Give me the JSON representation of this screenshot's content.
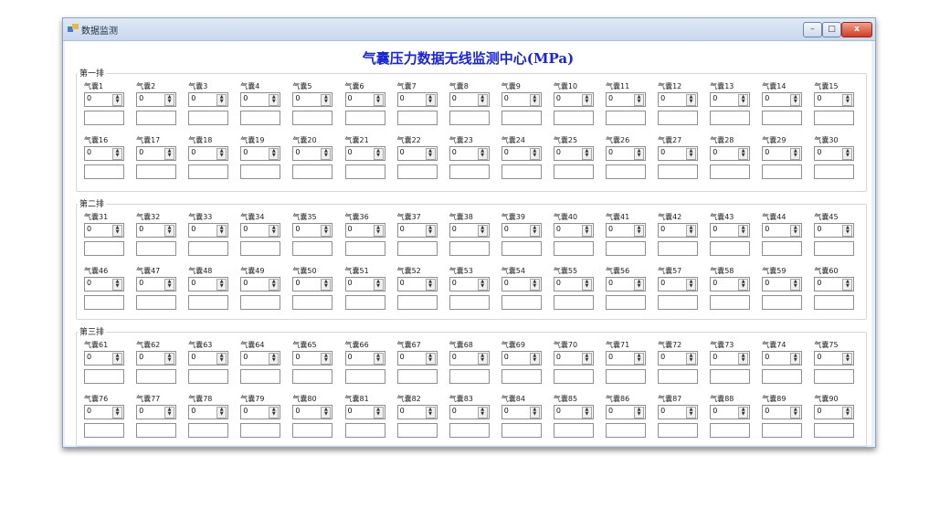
{
  "window": {
    "title": "数据监测",
    "min": "–",
    "max": "□",
    "close": "x"
  },
  "main_title": "气囊压力数据无线监测中心(MPa)",
  "groups": [
    {
      "label": "第一排",
      "start": 1
    },
    {
      "label": "第二排",
      "start": 31
    },
    {
      "label": "第三排",
      "start": 61
    }
  ],
  "cell_prefix": "气囊",
  "cells": {
    "1": "0",
    "2": "0",
    "3": "0",
    "4": "0",
    "5": "0",
    "6": "0",
    "7": "0",
    "8": "0",
    "9": "0",
    "10": "0",
    "11": "0",
    "12": "0",
    "13": "0",
    "14": "0",
    "15": "0",
    "16": "0",
    "17": "0",
    "18": "0",
    "19": "0",
    "20": "0",
    "21": "0",
    "22": "0",
    "23": "0",
    "24": "0",
    "25": "0",
    "26": "0",
    "27": "0",
    "28": "0",
    "29": "0",
    "30": "0",
    "31": "0",
    "32": "0",
    "33": "0",
    "34": "0",
    "35": "0",
    "36": "0",
    "37": "0",
    "38": "0",
    "39": "0",
    "40": "0",
    "41": "0",
    "42": "0",
    "43": "0",
    "44": "0",
    "45": "0",
    "46": "0",
    "47": "0",
    "48": "0",
    "49": "0",
    "50": "0",
    "51": "0",
    "52": "0",
    "53": "0",
    "54": "0",
    "55": "0",
    "56": "0",
    "57": "0",
    "58": "0",
    "59": "0",
    "60": "0",
    "61": "0",
    "62": "0",
    "63": "0",
    "64": "0",
    "65": "0",
    "66": "0",
    "67": "0",
    "68": "0",
    "69": "0",
    "70": "0",
    "71": "0",
    "72": "0",
    "73": "0",
    "74": "0",
    "75": "0",
    "76": "0",
    "77": "0",
    "78": "0",
    "79": "0",
    "80": "0",
    "81": "0",
    "82": "0",
    "83": "0",
    "84": "0",
    "85": "0",
    "86": "0",
    "87": "0",
    "88": "0",
    "89": "0",
    "90": "0"
  },
  "outputs": {
    "1": "",
    "2": "",
    "3": "",
    "4": "",
    "5": "",
    "6": "",
    "7": "",
    "8": "",
    "9": "",
    "10": "",
    "11": "",
    "12": "",
    "13": "",
    "14": "",
    "15": "",
    "16": "",
    "17": "",
    "18": "",
    "19": "",
    "20": "",
    "21": "",
    "22": "",
    "23": "",
    "24": "",
    "25": "",
    "26": "",
    "27": "",
    "28": "",
    "29": "",
    "30": "",
    "31": "",
    "32": "",
    "33": "",
    "34": "",
    "35": "",
    "36": "",
    "37": "",
    "38": "",
    "39": "",
    "40": "",
    "41": "",
    "42": "",
    "43": "",
    "44": "",
    "45": "",
    "46": "",
    "47": "",
    "48": "",
    "49": "",
    "50": "",
    "51": "",
    "52": "",
    "53": "",
    "54": "",
    "55": "",
    "56": "",
    "57": "",
    "58": "",
    "59": "",
    "60": "",
    "61": "",
    "62": "",
    "63": "",
    "64": "",
    "65": "",
    "66": "",
    "67": "",
    "68": "",
    "69": "",
    "70": "",
    "71": "",
    "72": "",
    "73": "",
    "74": "",
    "75": "",
    "76": "",
    "77": "",
    "78": "",
    "79": "",
    "80": "",
    "81": "",
    "82": "",
    "83": "",
    "84": "",
    "85": "",
    "86": "",
    "87": "",
    "88": "",
    "89": "",
    "90": ""
  },
  "spin_icon": "up-down-arrows-icon",
  "colors": {
    "title": "#1a26d6",
    "window_border": "#8fa6c4",
    "close": "#cf3d22"
  }
}
